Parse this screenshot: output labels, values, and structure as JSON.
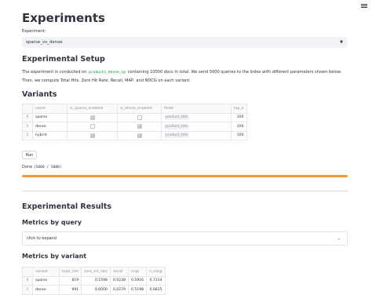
{
  "menu_icon": "hamburger-menu-icon",
  "title": "Experiments",
  "experiment": {
    "label": "Experiment:",
    "value": "sparse_vs_dense",
    "chevron_icon": "chevron-down-icon"
  },
  "setup": {
    "heading": "Experimental Setup",
    "text_before": "The experiment is conducted on ",
    "index_name": "products_dense_ip",
    "text_after": " containing 10000 docs in total. We send 5000 queries to the index with different parameters shown below. Then, we compute Total Hits, Zero Hit Rate, Recall, MAP, and NDCG on each variant."
  },
  "variants": {
    "heading": "Variants",
    "columns": [
      "",
      "name",
      "is_sparse_enabled",
      "is_dense_enabled",
      "fields",
      "top_k"
    ],
    "rows": [
      {
        "idx": "0",
        "name": "sparse",
        "is_sparse_enabled": true,
        "is_dense_enabled": false,
        "fields": "product_title",
        "top_k": "100"
      },
      {
        "idx": "1",
        "name": "dense",
        "is_sparse_enabled": false,
        "is_dense_enabled": true,
        "fields": "product_title",
        "top_k": "100"
      },
      {
        "idx": "2",
        "name": "hybrid",
        "is_sparse_enabled": true,
        "is_dense_enabled": true,
        "fields": "product_title",
        "top_k": "100"
      }
    ]
  },
  "run_button": "Run",
  "progress": {
    "status": "Done",
    "text": "(5000 / 5000)",
    "fraction": 1.0,
    "color": "#f09c33"
  },
  "results": {
    "heading": "Experimental Results",
    "by_query": {
      "heading": "Metrics by query",
      "expander_label": "click to expand",
      "chevron_icon": "chevron-down-icon"
    },
    "by_variant": {
      "heading": "Metrics by variant",
      "columns": [
        "",
        "variant",
        "total_hits",
        "zero_hit_rate",
        "recall",
        "map",
        "n_ndcg"
      ],
      "rows": [
        {
          "idx": "0",
          "variant": "sparse",
          "total_hits": "819",
          "zero_hit_rate": "0.1598",
          "recall": "0.0238",
          "map": "0.5916",
          "n_ndcg": "0.7314"
        },
        {
          "idx": "1",
          "variant": "dense",
          "total_hits": "991",
          "zero_hit_rate": "0.0000",
          "recall": "0.0279",
          "map": "0.5198",
          "n_ndcg": "0.6825"
        }
      ]
    }
  }
}
